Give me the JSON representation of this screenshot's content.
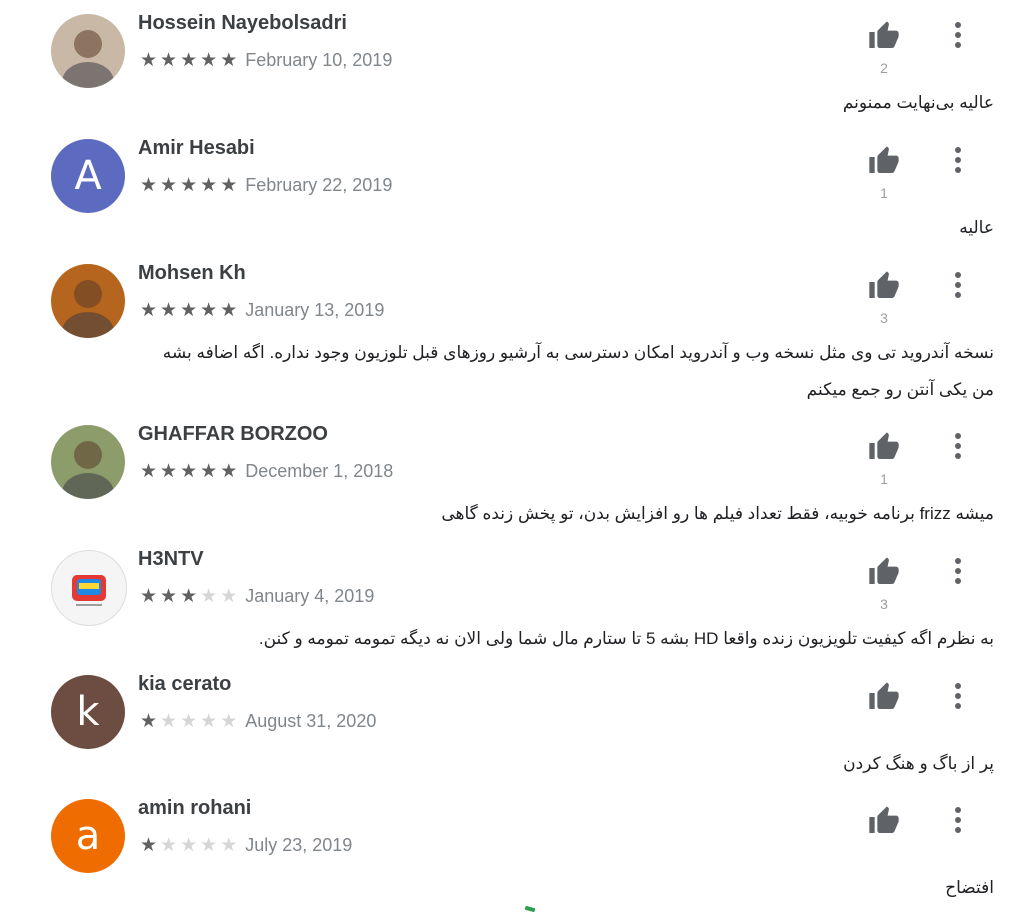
{
  "reviews": [
    {
      "name": "Hossein Nayebolsadri",
      "stars": 5,
      "date": "February 10, 2019",
      "text": "عالیه بی‌نهایت ممنونم",
      "likes": "2",
      "avatar": {
        "type": "photo",
        "color": "#c9b8a6"
      }
    },
    {
      "name": "Amir Hesabi",
      "stars": 5,
      "date": "February 22, 2019",
      "text": "عالیه",
      "likes": "1",
      "avatar": {
        "type": "letter",
        "letter": "A",
        "color": "#5c6bc0"
      }
    },
    {
      "name": "Mohsen Kh",
      "stars": 5,
      "date": "January 13, 2019",
      "text": "نسخه آندروید تی وی مثل نسخه وب و آندروید امکان دسترسی به آرشیو روزهای قبل تلوزیون وجود نداره. اگه اضافه بشه من یکی آنتن رو جمع میکنم",
      "likes": "3",
      "avatar": {
        "type": "photo",
        "color": "#b5651d"
      }
    },
    {
      "name": "GHAFFAR BORZOO",
      "stars": 5,
      "date": "December 1, 2018",
      "text": "میشه frizz برنامه خوبیه، فقط تعداد فیلم ها رو افزایش بدن، تو پخش زنده گاهی",
      "likes": "1",
      "avatar": {
        "type": "photo",
        "color": "#8d9c6b"
      }
    },
    {
      "name": "H3NTV",
      "stars": 3,
      "date": "January 4, 2019",
      "text": "به نظرم اگه کیفیت تلویزیون زنده واقعا HD بشه 5 تا ستارم مال شما ولی الان نه دیگه تمومه تمومه و کنن.",
      "likes": "3",
      "avatar": {
        "type": "logo",
        "color": "#f5f5f5"
      }
    },
    {
      "name": "kia cerato",
      "stars": 1,
      "date": "August 31, 2020",
      "text": "پر از باگ و هنگ کردن",
      "likes": "",
      "avatar": {
        "type": "letter",
        "letter": "k",
        "color": "#6d4c41"
      }
    },
    {
      "name": "amin rohani",
      "stars": 1,
      "date": "July 23, 2019",
      "text": "افتضاح",
      "likes": "",
      "avatar": {
        "type": "letter",
        "letter": "a",
        "color": "#ef6c00"
      }
    }
  ],
  "icons": {
    "like": "thumb-up-icon",
    "more": "more-vert-icon",
    "star": "star-icon"
  }
}
